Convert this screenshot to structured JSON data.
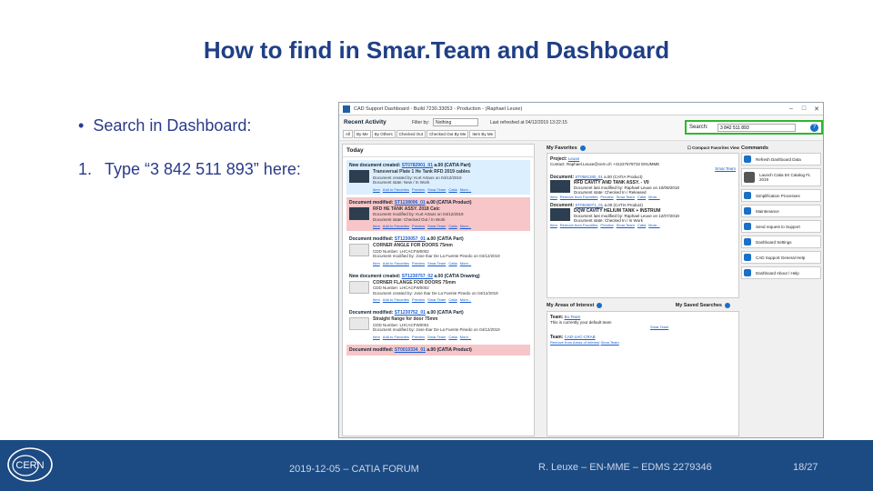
{
  "title": "How to find in Smar.Team and Dashboard",
  "bullet": {
    "dot": "•",
    "text": "Search in Dashboard:"
  },
  "step": {
    "num": "1.",
    "text": "Type “3 842 511 893” here:"
  },
  "app": {
    "window_title": "CAD Support Dashboard - Build 7230.33053 - Production - (Raphael Leuxe)",
    "window_controls": [
      "–",
      "□",
      "✕"
    ],
    "recent_activity_label": "Recent Activity",
    "filter_label": "Filter by:",
    "filter_value": "Nothing",
    "last_refreshed": "Last refreshed at 04/12/2019 13:22:15",
    "tabs": [
      "All",
      "By Me",
      "By Others",
      "Checked Out",
      "Checked Out By Me",
      "Item By Me"
    ],
    "search_label": "Search:",
    "search_value": "3 842 511 893",
    "today_label": "Today",
    "cards": [
      {
        "head": "New document created:",
        "link": "ST0782901_01",
        "type": "a.00 (CATIA Part)",
        "title": "Transversal Plate 1 He Tank RFD 2019 cables",
        "l1": "Document created by: Kurt Artaos on 04/12/2019",
        "l2": "Document state: New / In Work"
      },
      {
        "head": "Document modified:",
        "link": "ST1138006_01",
        "type": "a.00 (CATIA Product)",
        "title": "RFD HE TANK ASSY. 2018 Calc",
        "l1": "Document modified by: Kurt Artaos on 04/12/2019",
        "l2": "Document state: Checked Out / In Work"
      },
      {
        "head": "Document modified:",
        "link": "ST1230057_01",
        "type": "a.00 (CATIA Part)",
        "title": "CORNER ANGLE FOR DOORS 75mm",
        "l1": "CDD Number: LHCACFW0002",
        "l2": "Document modified by: Jose Ibar De La Fuente Pinedo on 04/12/2019"
      },
      {
        "head": "New document created:",
        "link": "ST1230757_02",
        "type": "a.00 (CATIA Drawing)",
        "title": "CORNER FLANGE FOR DOORS 75mm",
        "l1": "CDD Number: LHCACFW0002",
        "l2": "Document created by: Jose Ibar De La Fuente Pinedo on 04/12/2019"
      },
      {
        "head": "Document modified:",
        "link": "ST1230752_01",
        "type": "a.00 (CATIA Part)",
        "title": "Straight flange for door 75mm",
        "l1": "CDD Number: LHCACFW0001",
        "l2": "Document modified by: Jose Ibar De La Fuente Pinedo on 04/12/2019"
      },
      {
        "head": "Document modified:",
        "link": "ST0010334_01",
        "type": "a.00 (CATIA Product)",
        "title": "",
        "l1": "",
        "l2": ""
      }
    ],
    "card_links": [
      "Item",
      "Add to Favorites",
      "Preview",
      "Smar.Team",
      "Catia",
      "More..."
    ],
    "favorites_label": "My Favorites",
    "compact_label": "Compact Favorites View",
    "favorites": {
      "project_label": "Project:",
      "project_link": "Leuxe",
      "contact": "Contact: Raphael.Leuxe@cern.ch  +41227678732  ENUMME",
      "smarteam": "Smar.Team",
      "items": [
        {
          "head": "Document:",
          "link": "ST0581180_01",
          "type": "a.00 (CATIA Product)",
          "title": "RFD CAVITY AND TANK ASSY. - V0",
          "l1": "Document last modified by: Raphael Leuxe on 10/08/2018",
          "l2": "Document state: Checked In / Released"
        },
        {
          "head": "Document:",
          "link": "ST0526071_01",
          "type": "a.00 (CATIA Product)",
          "title": "DQW CAVITY HELIUM TANK + INSTRUM",
          "l1": "Document last modified by: Raphael Leuxe on 12/07/2018",
          "l2": "Document state: Checked In / In Work"
        }
      ],
      "item_links": [
        "Item",
        "Remove from Favorites",
        "Preview",
        "Smar.Team",
        "Catia",
        "More..."
      ]
    },
    "areas_label": "My Areas of Interest",
    "saved_label": "My Saved Searches",
    "areas": [
      {
        "label": "Team:",
        "link": "Bo Team",
        "sub": "This is currently your default team",
        "action": "Smar.Team"
      },
      {
        "label": "Team:",
        "link": "CAD-LHC-CRAB",
        "sub": "Remove from Areas of Interest",
        "action": "Smar.Team"
      }
    ],
    "commands_label": "Commands",
    "commands": [
      {
        "label": "Refresh Dashboard Data",
        "color": "#1a6fc7"
      },
      {
        "label": "Launch Catia 5X Catalog FL 2019",
        "color": "#555555"
      },
      {
        "label": "Simplification Processes",
        "color": "#2f6db0"
      },
      {
        "label": "Maintenance",
        "color": "#4a4a4a"
      },
      {
        "label": "Send request to Support",
        "color": "#2f6db0"
      },
      {
        "label": "Dashboard Settings",
        "color": "#555555"
      },
      {
        "label": "CAD Support General Help",
        "color": "#1a6fc7"
      },
      {
        "label": "Dashboard About / Help",
        "color": "#1a6fc7"
      }
    ]
  },
  "footer": {
    "date_event": "2019-12-05 – CATIA FORUM",
    "author": "R. Leuxe – EN-MME – EDMS 2279346",
    "page": "18/27",
    "logo_text": "CERN"
  },
  "colors": {
    "title": "#1f3f86",
    "footer_bg": "#1c4a82",
    "search_highlight": "#2db82d"
  }
}
